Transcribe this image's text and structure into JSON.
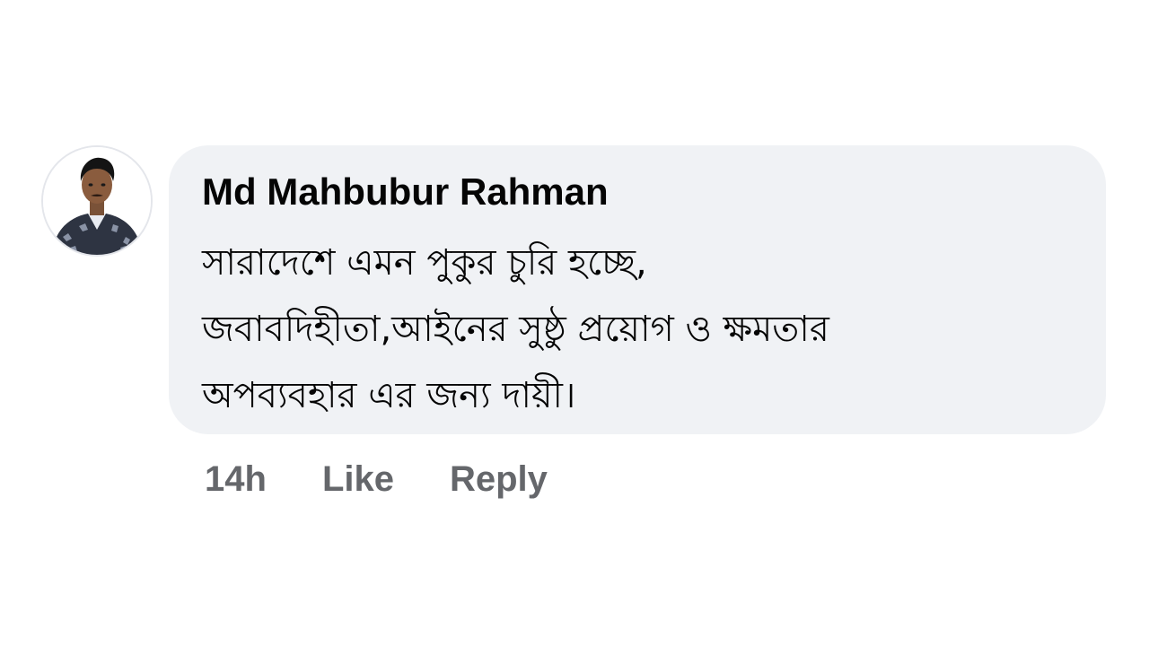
{
  "comment": {
    "author": "Md Mahbubur Rahman",
    "text": "সারাদেশে এমন পুকুর চুরি হচ্ছে,\nজবাবদিহীতা,আইনের সুষ্ঠু প্রয়োগ ও ক্ষমতার\nঅপব্যবহার এর জন্য দায়ী।",
    "time": "14h",
    "like_label": "Like",
    "reply_label": "Reply"
  },
  "colors": {
    "bubble_background": "#f0f2f5",
    "text": "#050505",
    "secondary_text": "#65676b"
  }
}
